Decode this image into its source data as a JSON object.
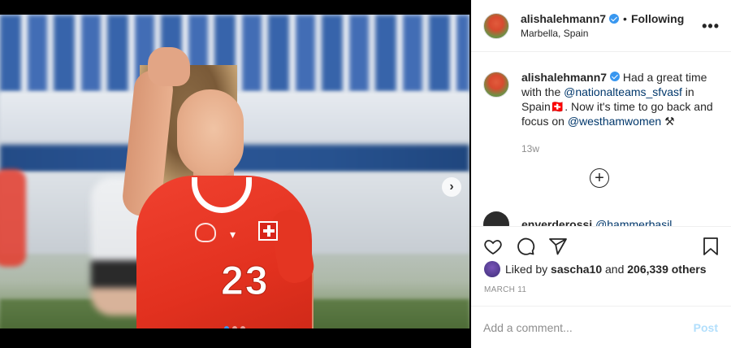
{
  "post": {
    "username": "alishalehmann7",
    "separator": "•",
    "follow_status": "Following",
    "location": "Marbella, Spain",
    "more_icon": "•••"
  },
  "photo": {
    "jersey_number": "23",
    "brand": "PUMA",
    "next_icon": "chevron-right-icon",
    "carousel_slides": 3,
    "carousel_active": 1
  },
  "caption": {
    "username": "alishalehmann7",
    "text_1": " Had a great time with the ",
    "mention_1": "@nationalteams_sfvasf",
    "text_2": " in Spain🇨🇭. Now it's time to go back and focus on ",
    "mention_2": "@westhamwomen",
    "text_3": " ⚒",
    "time_ago": "13w"
  },
  "load_more": "+",
  "comment2": {
    "username": "enverderossi",
    "mention": "@hammerbasil"
  },
  "likes": {
    "prefix": "Liked by ",
    "user": "sascha10",
    "middle": " and ",
    "count": "206,339 others"
  },
  "date": "MARCH 11",
  "add_comment": {
    "placeholder": "Add a comment...",
    "post_label": "Post"
  },
  "colors": {
    "link": "#00376b",
    "verified": "#3897f0",
    "post_disabled": "#b2dffc",
    "muted": "#8e8e8e"
  }
}
